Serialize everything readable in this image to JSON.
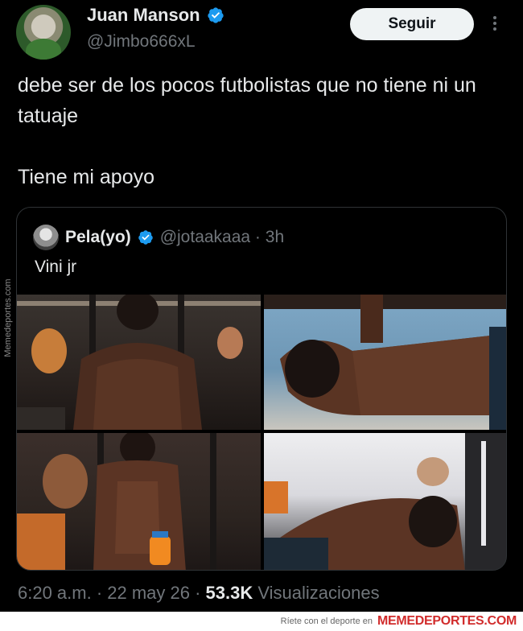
{
  "author": {
    "name": "Juan Manson",
    "handle": "@Jimbo666xL",
    "verified": true
  },
  "actions": {
    "follow_label": "Seguir",
    "more_icon": "more-vertical-icon"
  },
  "tweet": {
    "line1": "debe ser de los pocos futbolistas que no tiene ni un tatuaje",
    "line2": "Tiene mi apoyo"
  },
  "quoted_tweet": {
    "name": "Pela(yo)",
    "handle_time": "@jotaakaaa · 3h",
    "verified": true,
    "text": "Vini jr",
    "media_count": 4
  },
  "meta": {
    "time_date": "6:20 a.m. · 22 may 26 · ",
    "views_count": "53.3K",
    "views_label": " Visualizaciones"
  },
  "watermark": {
    "side": "Memedeportes.com",
    "footer_small": "Ríete con el deporte en",
    "footer_brand": "MEMEDEPORTES.COM"
  },
  "colors": {
    "background": "#000000",
    "text": "#e7e9ea",
    "secondary": "#71767b",
    "verified_blue": "#1d9bf0",
    "button_bg": "#eff3f4",
    "border": "#2f3336"
  }
}
